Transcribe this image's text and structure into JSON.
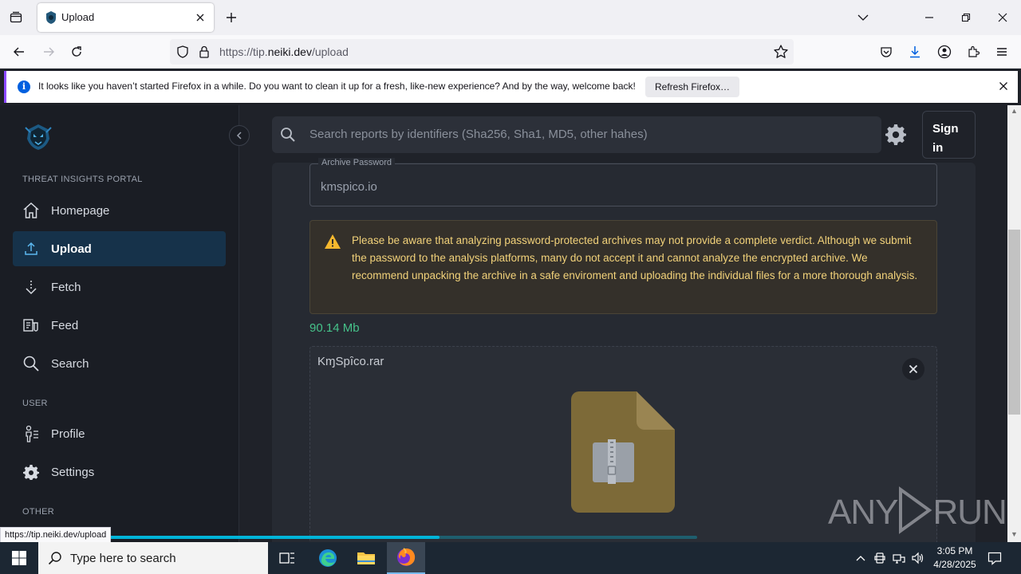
{
  "browser": {
    "tab_title": "Upload",
    "url_prefix": "https://tip.",
    "url_domain": "neiki.dev",
    "url_path": "/upload",
    "status_link": "https://tip.neiki.dev/upload"
  },
  "notification": {
    "message": "It looks like you haven’t started Firefox in a while. Do you want to clean it up for a fresh, like-new experience? And by the way, welcome back!",
    "button": "Refresh Firefox…"
  },
  "sidebar": {
    "section_portal": "THREAT INSIGHTS PORTAL",
    "section_user": "USER",
    "section_other": "OTHER",
    "items": [
      {
        "label": "Homepage",
        "icon": "home-icon"
      },
      {
        "label": "Upload",
        "icon": "upload-icon",
        "active": true
      },
      {
        "label": "Fetch",
        "icon": "fetch-icon"
      },
      {
        "label": "Feed",
        "icon": "feed-icon"
      },
      {
        "label": "Search",
        "icon": "search-icon"
      },
      {
        "label": "Profile",
        "icon": "profile-icon"
      },
      {
        "label": "Settings",
        "icon": "gear-icon"
      }
    ]
  },
  "header": {
    "search_placeholder": "Search reports by identifiers (Sha256, Sha1, MD5, other hahes)",
    "signin_label": "Sign in"
  },
  "upload": {
    "password_legend": "Archive Password",
    "password_value": "kmspico.io",
    "warning": "Please be aware that analyzing password-protected archives may not provide a complete verdict. Although we submit the password to the analysis platforms, many do not accept it and cannot analyze the encrypted archive. We recommend unpacking the archive in a safe enviroment and uploading the individual files for a more thorough analysis.",
    "file_size": "90.14 Mb",
    "file_name": "KɱSpȋco.rar",
    "progress": 0.59
  },
  "watermark": {
    "left": "ANY",
    "right": "RUN"
  },
  "taskbar": {
    "search_placeholder": "Type here to search",
    "time": "3:05 PM",
    "date": "4/28/2025"
  },
  "colors": {
    "accent": "#00b4d8",
    "warning_text": "#f2d27a",
    "size_text": "#46c28a",
    "active_nav": "#16324a"
  }
}
